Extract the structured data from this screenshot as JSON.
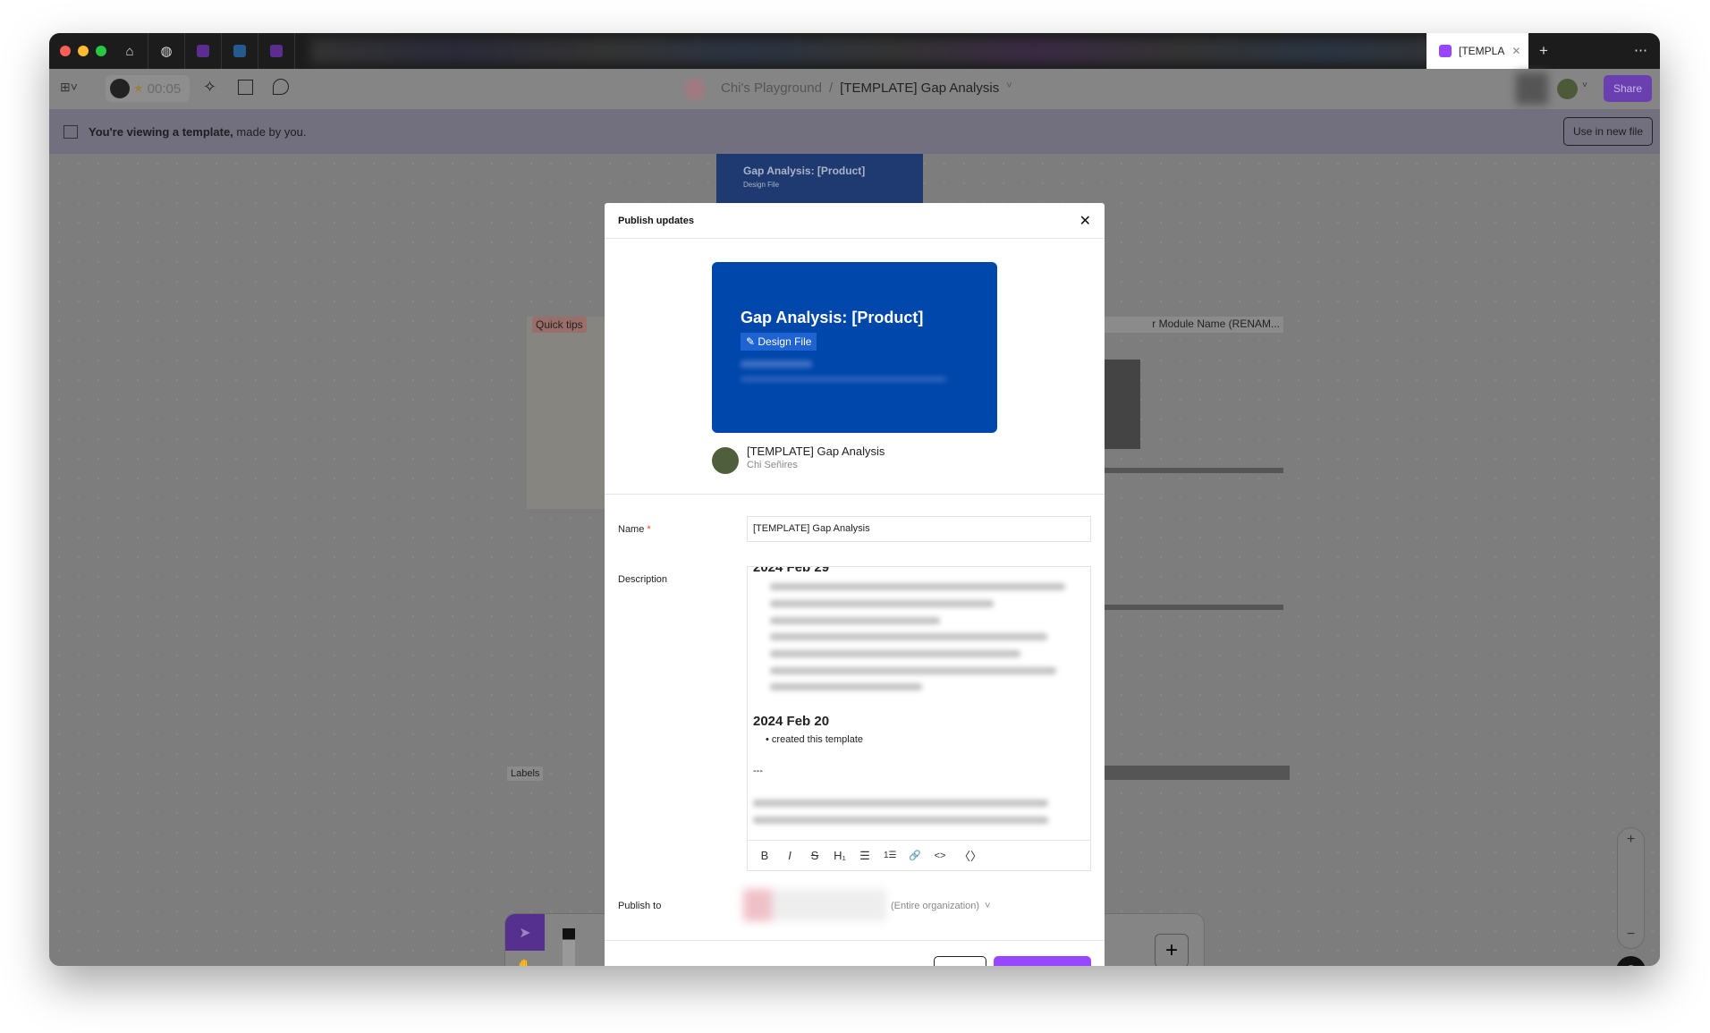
{
  "tabs": {
    "active_label": "[TEMPLA",
    "new_tab": "+",
    "more": "⋯"
  },
  "toolbar": {
    "timer": "00:05",
    "breadcrumb_team": "Chi's Playground",
    "breadcrumb_sep": "/",
    "file_name": "[TEMPLATE] Gap Analysis",
    "share": "Share"
  },
  "banner": {
    "bold": "You're viewing a template,",
    "rest": " made by you.",
    "use_button": "Use in new file"
  },
  "canvas": {
    "frame_title": "Gap Analysis: [Product]",
    "frame_tag": "Design File",
    "quick_tips": "Quick tips",
    "module_title": "r Module Name (RENAM...",
    "labels": "Labels"
  },
  "modal": {
    "title": "Publish updates",
    "thumbnail": {
      "title": "Gap Analysis: [Product]",
      "tag": "Design File"
    },
    "file_name": "[TEMPLATE] Gap Analysis",
    "author": "Chi Señires",
    "name_label": "Name",
    "required": "*",
    "name_value": "[TEMPLATE] Gap Analysis",
    "description_label": "Description",
    "description": {
      "heading_partial": "2024 Feb 29",
      "heading2": "2024 Feb 20",
      "bullet": "created this template",
      "separator": "---"
    },
    "format_tools": [
      "B",
      "I",
      "S",
      "H₁",
      "☰",
      "1☰",
      "🔗",
      "<>",
      "〈〉"
    ],
    "publish_label": "Publish to",
    "publish_scope": "(Entire organization)"
  },
  "colors": {
    "accent": "#9747ff",
    "thumbnail": "#0047ab",
    "required": "#f24822"
  }
}
